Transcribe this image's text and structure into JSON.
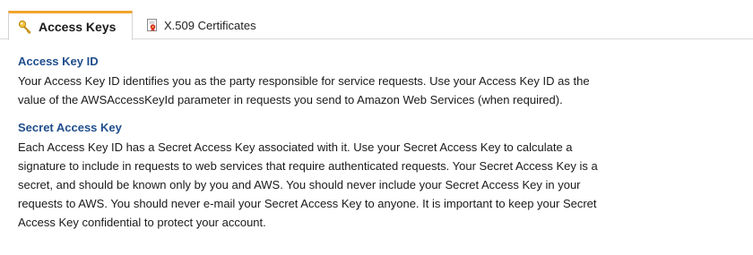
{
  "tabs": [
    {
      "label": "Access Keys",
      "icon": "key-icon",
      "active": true
    },
    {
      "label": "X.509 Certificates",
      "icon": "certificate-icon",
      "active": false
    }
  ],
  "sections": [
    {
      "title": "Access Key ID",
      "lines": [
        "Your Access Key ID identifies you as the party responsible for service requests. Use your Access Key ID as the",
        "value of the AWSAccessKeyId parameter in requests you send to Amazon Web Services (when required)."
      ]
    },
    {
      "title": "Secret Access Key",
      "lines": [
        "Each Access Key ID has a Secret Access Key associated with it. Use your Secret Access Key to calculate a",
        "signature to include in requests to web services that require authenticated requests. Your Secret Access Key is a",
        "secret, and should be known only by you and AWS. You should never include your Secret Access Key in your",
        "requests to AWS. You should never e-mail your Secret Access Key to anyone. It is important to keep your Secret",
        "Access Key confidential to protect your account."
      ]
    }
  ],
  "colors": {
    "active_tab_accent": "#f0a52e",
    "section_title": "#1f4e8c",
    "body_text": "#1a1a1a"
  }
}
